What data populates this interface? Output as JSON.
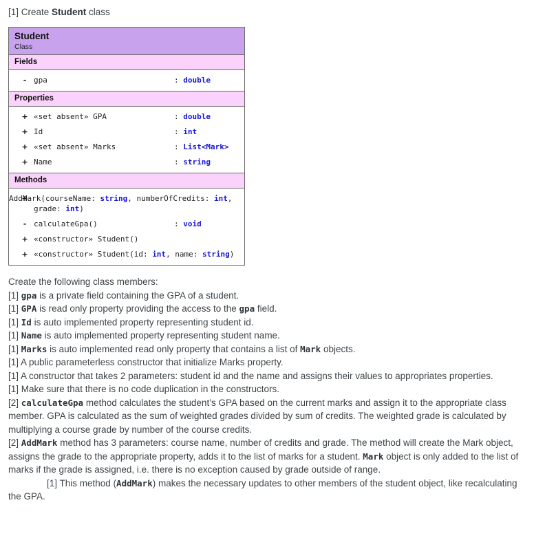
{
  "heading": {
    "marker": "[1] ",
    "pre": "Create ",
    "bold": "Student",
    "post": " class"
  },
  "uml": {
    "title": "Student",
    "stereotype": "Class",
    "colors": {
      "title_bar": "#c8a2ec",
      "section_bar": "#fbd2fb",
      "border": "#6b6b6b",
      "type_text": "#1a16d8"
    },
    "sections": [
      {
        "name": "Fields",
        "rows": [
          {
            "visibility": "-",
            "signature": "gpa",
            "colon": ":",
            "type": "double",
            "wrap": false
          }
        ]
      },
      {
        "name": "Properties",
        "rows": [
          {
            "visibility": "+",
            "signature": "«set absent» GPA",
            "colon": ":",
            "type": "double",
            "wrap": false
          },
          {
            "visibility": "+",
            "signature": "Id",
            "colon": ":",
            "type": "int",
            "wrap": false
          },
          {
            "visibility": "+",
            "signature": "«set absent» Marks",
            "colon": ":",
            "type": "List<Mark>",
            "wrap": false
          },
          {
            "visibility": "+",
            "signature": "Name",
            "colon": ":",
            "type": "string",
            "wrap": false
          }
        ]
      },
      {
        "name": "Methods",
        "rows": [
          {
            "visibility": "+",
            "signature_parts": [
              {
                "text": "AddMark(courseName: ",
                "type": false
              },
              {
                "text": "string",
                "type": true
              },
              {
                "text": ", numberOfCredits: ",
                "type": false
              },
              {
                "text": "int",
                "type": true
              },
              {
                "text": ", grade: ",
                "type": false
              },
              {
                "text": "int",
                "type": true
              },
              {
                "text": ")",
                "type": false
              }
            ],
            "colon": "",
            "type": "",
            "wrap": true
          },
          {
            "visibility": "-",
            "signature": "calculateGpa()",
            "colon": ":",
            "type": "void",
            "wrap": false
          },
          {
            "visibility": "+",
            "signature": "«constructor» Student()",
            "colon": "",
            "type": "",
            "wrap": false
          },
          {
            "visibility": "+",
            "signature_parts": [
              {
                "text": "«constructor» Student(id: ",
                "type": false
              },
              {
                "text": "int",
                "type": true
              },
              {
                "text": ", name: ",
                "type": false
              },
              {
                "text": "string",
                "type": true
              },
              {
                "text": ")",
                "type": false
              }
            ],
            "colon": "",
            "type": "",
            "wrap": false
          }
        ]
      }
    ]
  },
  "body": {
    "intro": "Create the following class members:",
    "requirements": [
      {
        "parts": [
          {
            "text": "[1] ",
            "style": "plain"
          },
          {
            "text": "gpa",
            "style": "mono"
          },
          {
            "text": " is a private field containing the GPA of a student.",
            "style": "plain"
          }
        ]
      },
      {
        "parts": [
          {
            "text": "[1] ",
            "style": "plain"
          },
          {
            "text": "GPA",
            "style": "mono"
          },
          {
            "text": " is read only property providing the access to the ",
            "style": "plain"
          },
          {
            "text": "gpa",
            "style": "mono"
          },
          {
            "text": " field.",
            "style": "plain"
          }
        ]
      },
      {
        "parts": [
          {
            "text": "[1] ",
            "style": "plain"
          },
          {
            "text": "Id",
            "style": "mono"
          },
          {
            "text": " is auto implemented property representing student id.",
            "style": "plain"
          }
        ]
      },
      {
        "parts": [
          {
            "text": "[1] ",
            "style": "plain"
          },
          {
            "text": "Name",
            "style": "mono"
          },
          {
            "text": " is auto implemented property representing student name.",
            "style": "plain"
          }
        ]
      },
      {
        "parts": [
          {
            "text": "[1] ",
            "style": "plain"
          },
          {
            "text": "Marks",
            "style": "mono"
          },
          {
            "text": " is auto implemented read only property that contains a list of ",
            "style": "plain"
          },
          {
            "text": "Mark",
            "style": "mono"
          },
          {
            "text": " objects.",
            "style": "plain"
          }
        ]
      },
      {
        "parts": [
          {
            "text": "[1] A public parameterless constructor that initialize Marks property.",
            "style": "plain"
          }
        ]
      },
      {
        "parts": [
          {
            "text": "[1] A constructor that takes 2 parameters: student id and the name and assigns their values to appropriates properties.",
            "style": "plain"
          }
        ]
      },
      {
        "parts": [
          {
            "text": "[1] Make sure that there is no code duplication in the constructors.",
            "style": "plain"
          }
        ]
      },
      {
        "parts": [
          {
            "text": "[2] ",
            "style": "plain"
          },
          {
            "text": "calculateGpa",
            "style": "mono"
          },
          {
            "text": " method calculates the student’s GPA based on the current marks and assign it to the appropriate class member. GPA is calculated as the sum of weighted grades divided by sum of credits. The weighted grade is calculated by multiplying a course grade by number of the course credits.",
            "style": "plain"
          }
        ]
      },
      {
        "parts": [
          {
            "text": "[2] ",
            "style": "plain"
          },
          {
            "text": "AddMark",
            "style": "mono"
          },
          {
            "text": " method has 3 parameters: course name, number of credits and grade. The method will create the Mark object, assigns the grade to the appropriate property, adds it to the list of marks for a student. ",
            "style": "plain"
          },
          {
            "text": "Mark",
            "style": "mono"
          },
          {
            "text": " object is only added to the list of marks if the grade is assigned, i.e. there is no exception caused by grade outside of range.",
            "style": "plain"
          }
        ]
      },
      {
        "indent": true,
        "parts": [
          {
            "text": "[1] This method (",
            "style": "plain"
          },
          {
            "text": "AddMark",
            "style": "mono"
          },
          {
            "text": ") makes the necessary updates to other members of the student object, like recalculating the GPA.",
            "style": "plain"
          }
        ]
      }
    ]
  }
}
